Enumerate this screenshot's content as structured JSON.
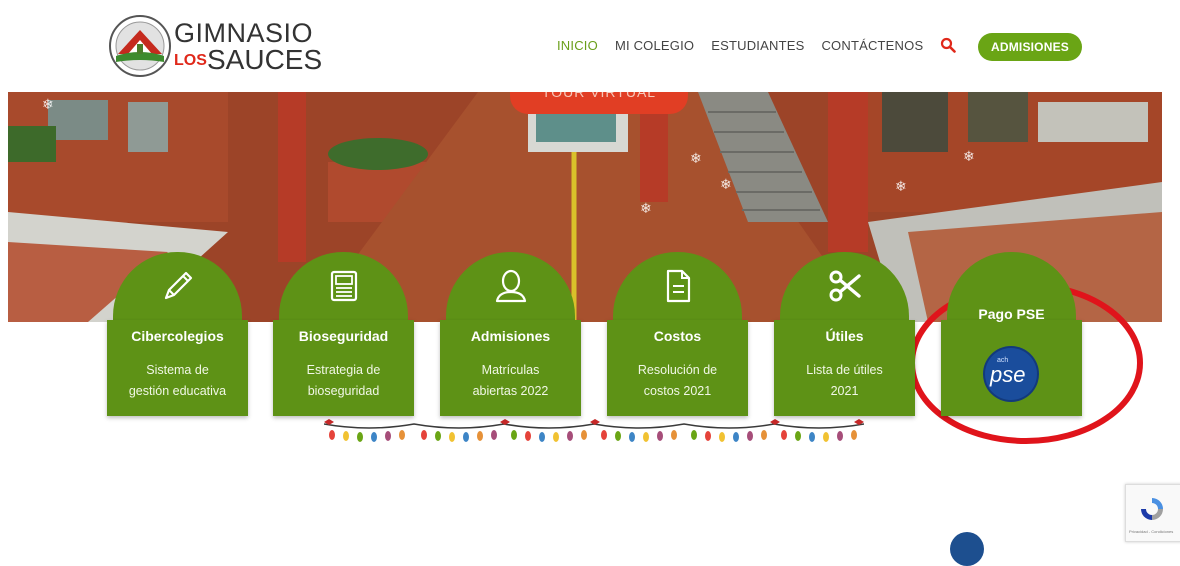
{
  "logo": {
    "line1": "GIMNASIO",
    "los": "LOS",
    "sauces": "SAUCES"
  },
  "nav": {
    "items": [
      "INICIO",
      "MI COLEGIO",
      "ESTUDIANTES",
      "CONTÁCTENOS"
    ],
    "cta": "ADMISIONES"
  },
  "hero": {
    "tour_label": "TOUR VIRTUAL"
  },
  "cards": [
    {
      "title": "Cibercolegios",
      "desc1": "Sistema de",
      "desc2": "gestión educativa",
      "icon": "pencil-icon"
    },
    {
      "title": "Bioseguridad",
      "desc1": "Estrategia de",
      "desc2": "bioseguridad",
      "icon": "newspaper-icon"
    },
    {
      "title": "Admisiones",
      "desc1": "Matrículas",
      "desc2": "abiertas 2022",
      "icon": "user-icon"
    },
    {
      "title": "Costos",
      "desc1": "Resolución de",
      "desc2": "costos 2021",
      "icon": "document-icon"
    },
    {
      "title": "Útiles",
      "desc1": "Lista de útiles",
      "desc2": "2021",
      "icon": "scissors-icon"
    },
    {
      "title": "Pago PSE",
      "logo_text": "pse",
      "logo_small": "ach",
      "icon": "pse-logo-icon"
    }
  ],
  "recaptcha": {
    "text": "Privacidad - Condiciones"
  },
  "colors": {
    "brand_green": "#6aa515",
    "card_green": "#5e9216",
    "accent_red": "#e13e24",
    "highlight": "#e0141b"
  }
}
